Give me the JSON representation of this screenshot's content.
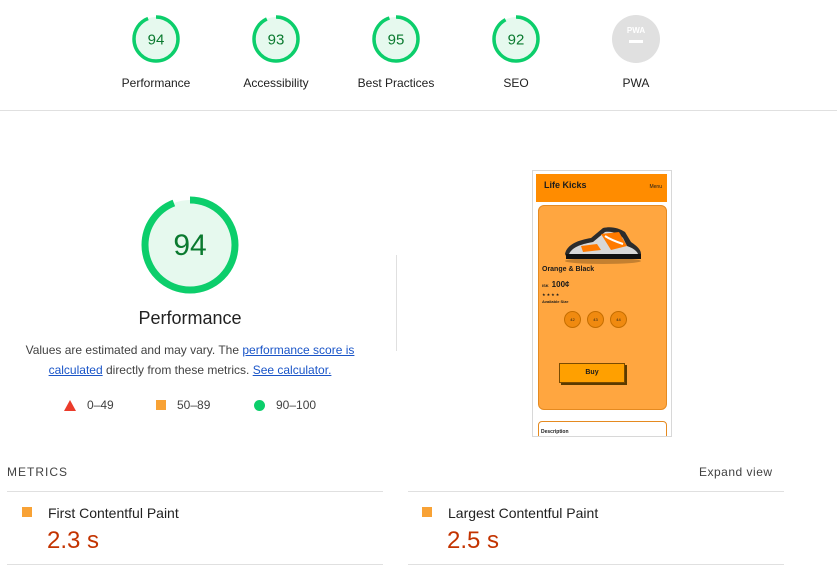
{
  "gauges": [
    {
      "label": "Performance",
      "score": "94"
    },
    {
      "label": "Accessibility",
      "score": "93"
    },
    {
      "label": "Best Practices",
      "score": "95"
    },
    {
      "label": "SEO",
      "score": "92"
    },
    {
      "label": "PWA",
      "score": "PWA"
    }
  ],
  "main": {
    "score": "94",
    "title": "Performance",
    "note_prefix": "Values are estimated and may vary. The ",
    "note_link1": "performance score is calculated",
    "note_mid": " directly from these metrics. ",
    "note_link2": "See calculator."
  },
  "legend": {
    "fail": "0–49",
    "average": "50–89",
    "pass": "90–100"
  },
  "screenshot": {
    "brand": "Life Kicks",
    "menu": "Menu",
    "product_name": "Orange & Black",
    "currency": "ISK",
    "price": "100¢",
    "stars": "★★★★",
    "available_size": "Available Size",
    "sizes": [
      "42",
      "43",
      "44"
    ],
    "buy": "Buy",
    "description": "Description"
  },
  "metrics": {
    "title": "METRICS",
    "expand": "Expand view",
    "items": [
      {
        "name": "First Contentful Paint",
        "value": "2.3 s"
      },
      {
        "name": "Largest Contentful Paint",
        "value": "2.5 s"
      }
    ]
  },
  "colors": {
    "pass": "#0cce6b",
    "average": "#f8a235",
    "fail": "#eb3b2a",
    "pass_text": "#0a7a2f",
    "metric_value": "#c33300"
  }
}
